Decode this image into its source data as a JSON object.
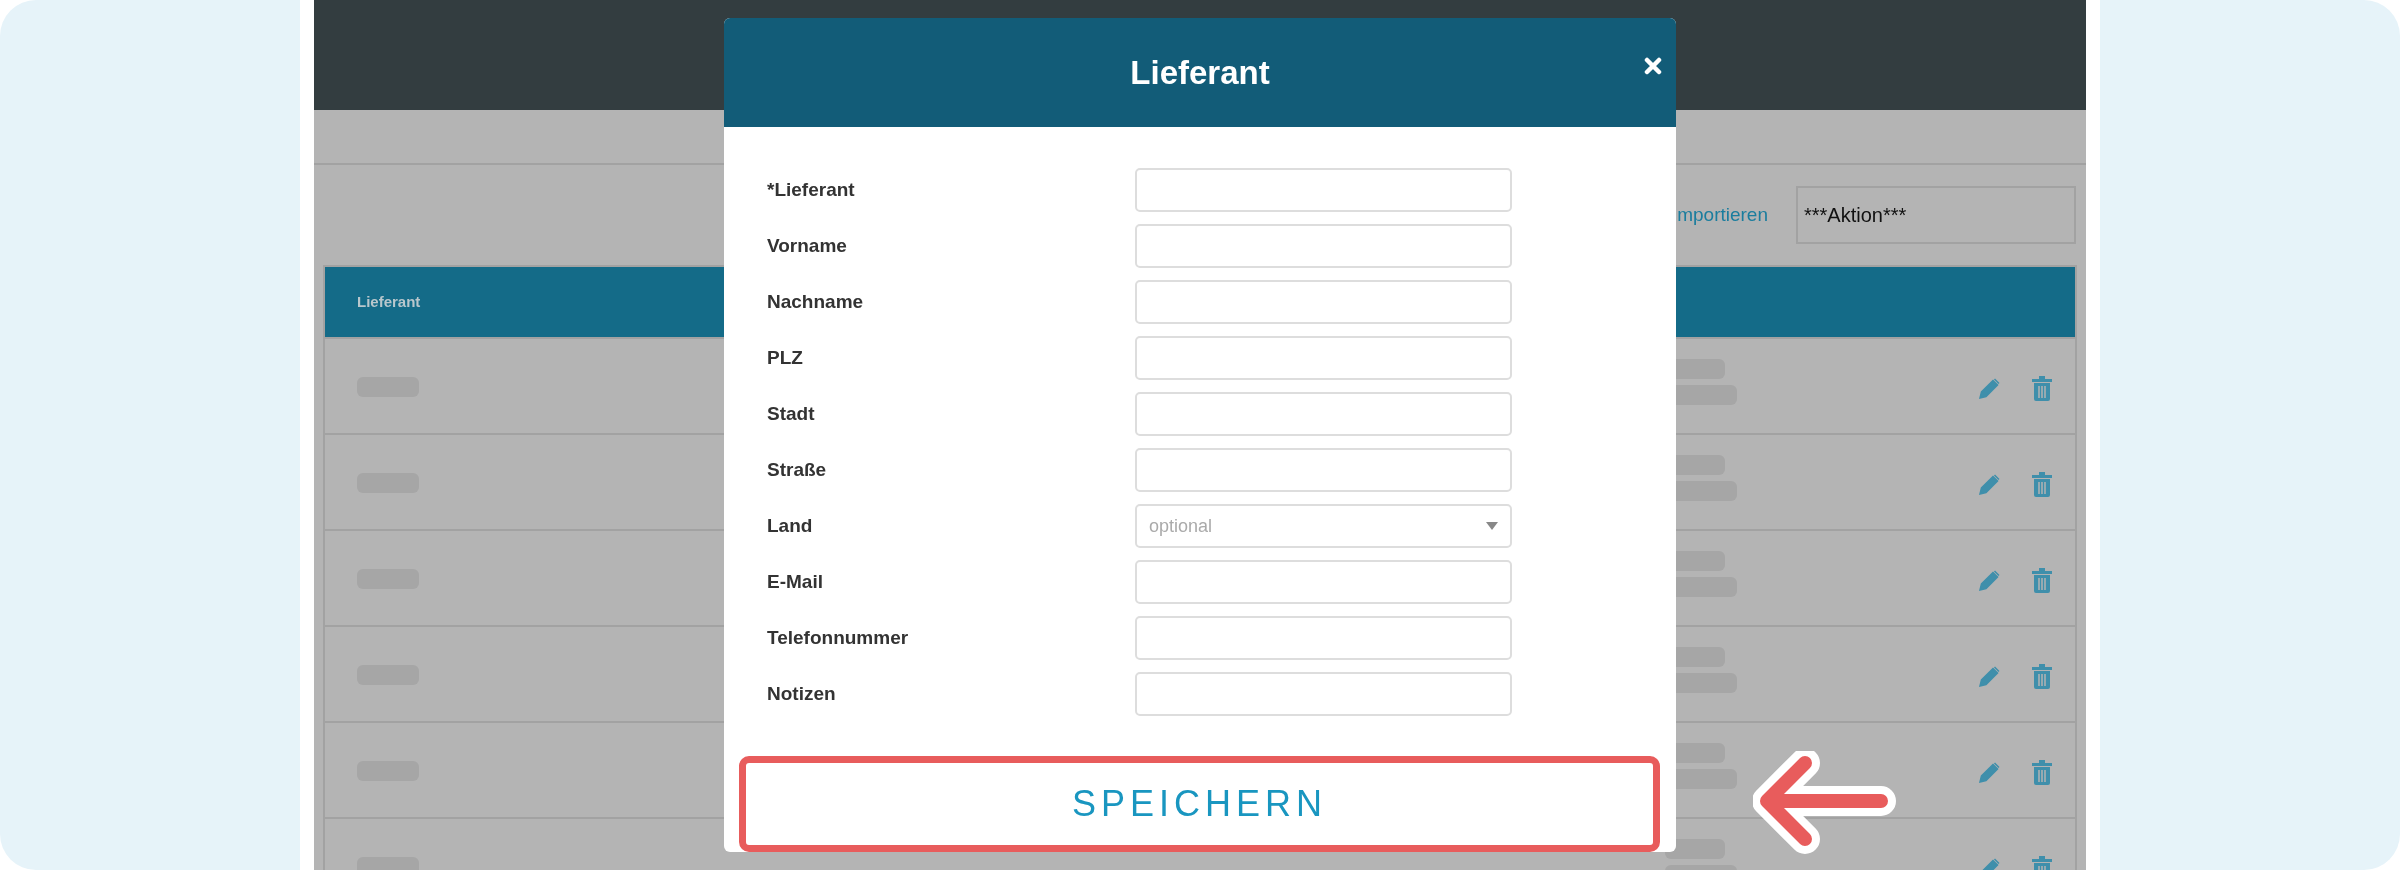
{
  "background_page": {
    "import_link": "mportieren",
    "action_select": "***Aktion***",
    "table": {
      "columns": [
        "Lieferant"
      ]
    }
  },
  "modal": {
    "title": "Lieferant",
    "fields": [
      {
        "label": "*Lieferant",
        "kind": "text"
      },
      {
        "label": "Vorname",
        "kind": "text"
      },
      {
        "label": "Nachname",
        "kind": "text"
      },
      {
        "label": "PLZ",
        "kind": "text"
      },
      {
        "label": "Stadt",
        "kind": "text"
      },
      {
        "label": "Straße",
        "kind": "text"
      },
      {
        "label": "Land",
        "kind": "select",
        "placeholder": "optional"
      },
      {
        "label": "E-Mail",
        "kind": "text"
      },
      {
        "label": "Telefonnummer",
        "kind": "text"
      },
      {
        "label": "Notizen",
        "kind": "text"
      }
    ],
    "save_button": "SPEICHERN"
  }
}
